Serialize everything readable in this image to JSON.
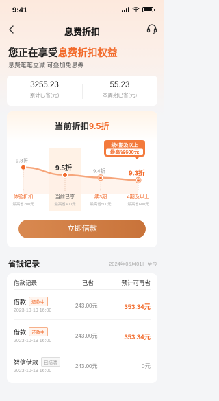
{
  "status_bar": {
    "time": "9:41"
  },
  "nav": {
    "title": "息费折扣"
  },
  "hero": {
    "title_prefix": "您正在享受",
    "title_highlight": "息费折扣权益",
    "subtitle": "息费笔笔立减 可叠加免息券"
  },
  "stats": [
    {
      "value": "3255.23",
      "label": "累计已省(元)"
    },
    {
      "value": "55.23",
      "label": "本周期已省(元)"
    }
  ],
  "discount": {
    "current_label": "当前折扣",
    "current_rate": "9.5折",
    "bubble": {
      "line1": "续4期及以上",
      "line2": "最高省600元"
    },
    "button_label": "立即借款",
    "chart_data": {
      "type": "line",
      "title": "当前折扣9.5折",
      "categories": [
        "体验折扣",
        "当前已享",
        "续3期",
        "4期及以上"
      ],
      "category_notes": [
        "最高省200元",
        "最高省400元",
        "最高省500元",
        "最高省600元"
      ],
      "values": [
        9.8,
        9.5,
        9.4,
        9.3
      ],
      "value_labels": [
        "9.8折",
        "9.5折",
        "9.4折",
        "9.3折"
      ],
      "current_index": 1,
      "locked": [
        false,
        false,
        true,
        true
      ],
      "ylim": [
        9.2,
        9.9
      ],
      "colors": {
        "line": "#f6a57a",
        "accent": "#f26a2a",
        "highlight_bg": "#fff2e6"
      }
    }
  },
  "records": {
    "title": "省钱记录",
    "date_note": "2024年05月01日至今",
    "headers": [
      "借款记录",
      "已省",
      "预计可再省"
    ],
    "rows": [
      {
        "name": "借款",
        "tag": "还款中",
        "tag_done": false,
        "date": "2023-10-19  16:00",
        "amount": "243.00元",
        "save": "353.34元"
      },
      {
        "name": "借款",
        "tag": "还款中",
        "tag_done": false,
        "date": "2023-10-19  16:00",
        "amount": "243.00元",
        "save": "353.34元"
      },
      {
        "name": "智信借款",
        "tag": "已结清",
        "tag_done": true,
        "date": "2023-10-19  16:00",
        "amount": "243.00元",
        "save": "0元"
      }
    ]
  },
  "colors": {
    "accent": "#f26a2a",
    "button": "#d98950"
  }
}
